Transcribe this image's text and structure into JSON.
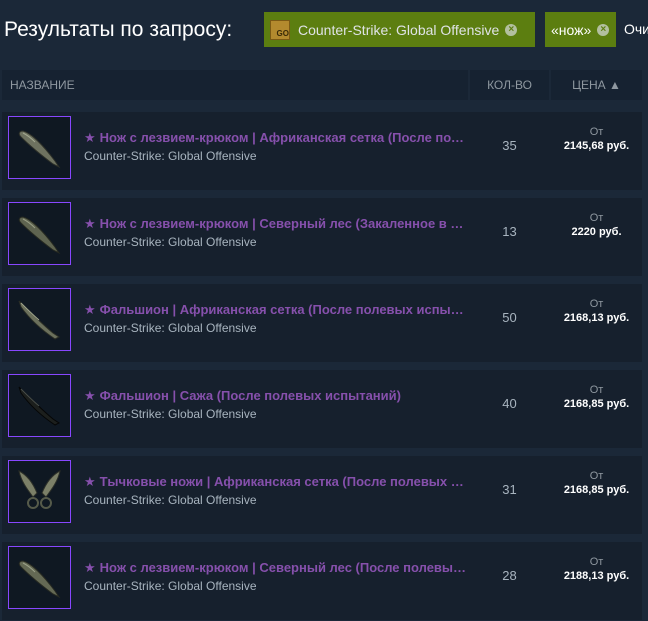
{
  "header": {
    "results_title": "Результаты по запросу:",
    "tags": [
      {
        "label": "Counter-Strike: Global Offensive",
        "close": "×"
      },
      {
        "label": "«нож»",
        "close": "×"
      }
    ],
    "clear_label": "Очи"
  },
  "columns": {
    "name": "НАЗВАНИЕ",
    "qty": "КОЛ-ВО",
    "price": "ЦЕНА ▲"
  },
  "rows": [
    {
      "name": "Нож с лезвием-крюком | Африканская сетка (После полевых испытаний)",
      "game": "Counter-Strike: Global Offensive",
      "qty": "35",
      "price_prefix": "От",
      "price": "2145,68 руб."
    },
    {
      "name": "Нож с лезвием-крюком | Северный лес (Закаленное в боях)",
      "game": "Counter-Strike: Global Offensive",
      "qty": "13",
      "price_prefix": "От",
      "price": "2220 руб."
    },
    {
      "name": "Фальшион | Африканская сетка (После полевых испытаний)",
      "game": "Counter-Strike: Global Offensive",
      "qty": "50",
      "price_prefix": "От",
      "price": "2168,13 руб."
    },
    {
      "name": "Фальшион | Сажа (После полевых испытаний)",
      "game": "Counter-Strike: Global Offensive",
      "qty": "40",
      "price_prefix": "От",
      "price": "2168,85 руб."
    },
    {
      "name": "Тычковые ножи | Африканская сетка (После полевых испытаний)",
      "game": "Counter-Strike: Global Offensive",
      "qty": "31",
      "price_prefix": "От",
      "price": "2168,85 руб."
    },
    {
      "name": "Нож с лезвием-крюком | Северный лес (После полевых испытаний)",
      "game": "Counter-Strike: Global Offensive",
      "qty": "28",
      "price_prefix": "От",
      "price": "2188,13 руб."
    }
  ],
  "colors": {
    "background": "#1b2838",
    "row_background": "#16202d",
    "item_name": "#8650ac",
    "tag_green": "#5c7e10",
    "thumb_border": "#8847ff"
  },
  "icons": {
    "star": "★",
    "knife_images": [
      "gut-knife-icon",
      "gut-knife-icon",
      "falchion-knife-icon",
      "falchion-knife-icon",
      "shadow-daggers-icon",
      "gut-knife-icon"
    ]
  }
}
